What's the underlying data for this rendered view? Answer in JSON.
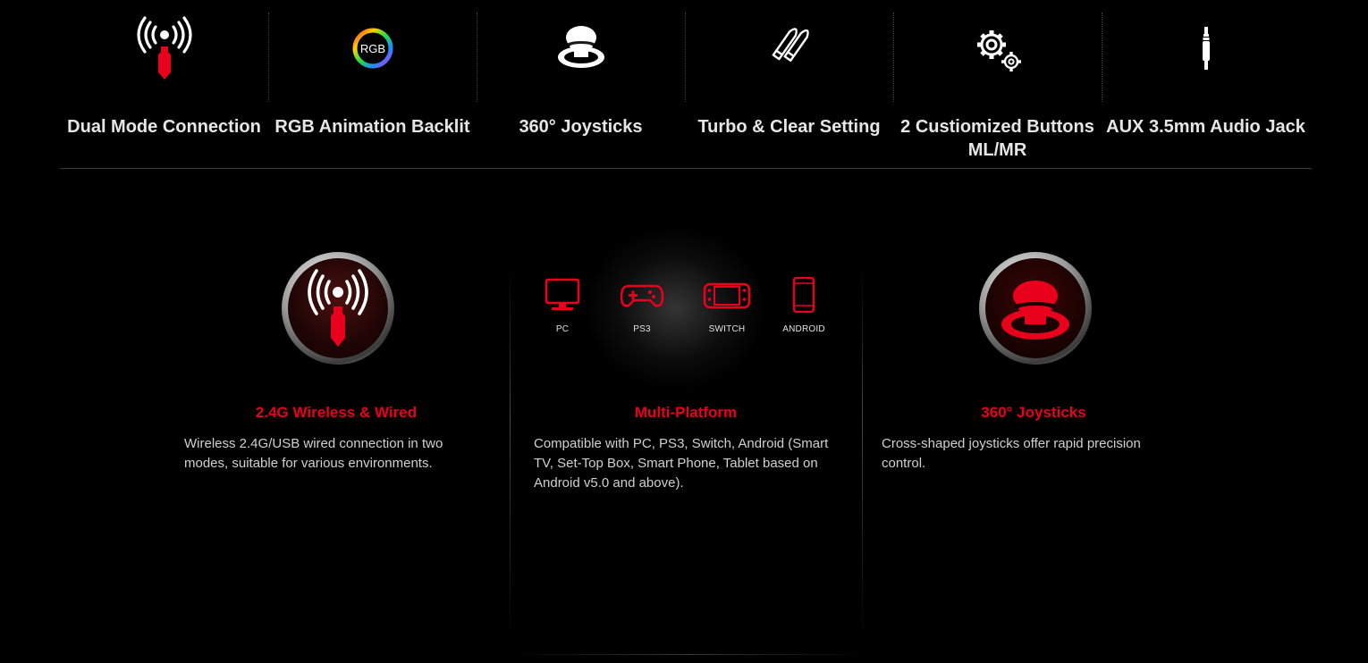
{
  "features": [
    {
      "label": "Dual Mode Connection",
      "icon": "wireless-dongle-icon"
    },
    {
      "label": "RGB Animation Backlit",
      "icon": "rgb-ring-icon",
      "icon_text": "RGB"
    },
    {
      "label": "360° Joysticks",
      "icon": "joystick-icon"
    },
    {
      "label": "Turbo & Clear Setting",
      "icon": "bullets-icon"
    },
    {
      "label": "2 Custiomized Buttons ML/MR",
      "icon": "gears-icon"
    },
    {
      "label": "AUX 3.5mm Audio Jack",
      "icon": "audio-jack-icon"
    }
  ],
  "columns": [
    {
      "title": "2.4G Wireless & Wired",
      "description": "Wireless 2.4G/USB wired connection in two modes, suitable for various environments."
    },
    {
      "title": "Multi-Platform",
      "description": "Compatible with PC, PS3, Switch, Android (Smart TV, Set-Top Box, Smart Phone, Tablet based on Android v5.0 and above).",
      "platforms": [
        {
          "label": "PC",
          "icon": "monitor-icon"
        },
        {
          "label": "PS3",
          "icon": "gamepad-icon"
        },
        {
          "label": "SWITCH",
          "icon": "switch-console-icon"
        },
        {
          "label": "ANDROID",
          "icon": "smartphone-icon"
        }
      ]
    },
    {
      "title": "360° Joysticks",
      "description": "Cross-shaped joysticks offer rapid precision control."
    }
  ],
  "colors": {
    "accent": "#e8001c",
    "background": "#000000",
    "text": "#e6e6e6"
  }
}
